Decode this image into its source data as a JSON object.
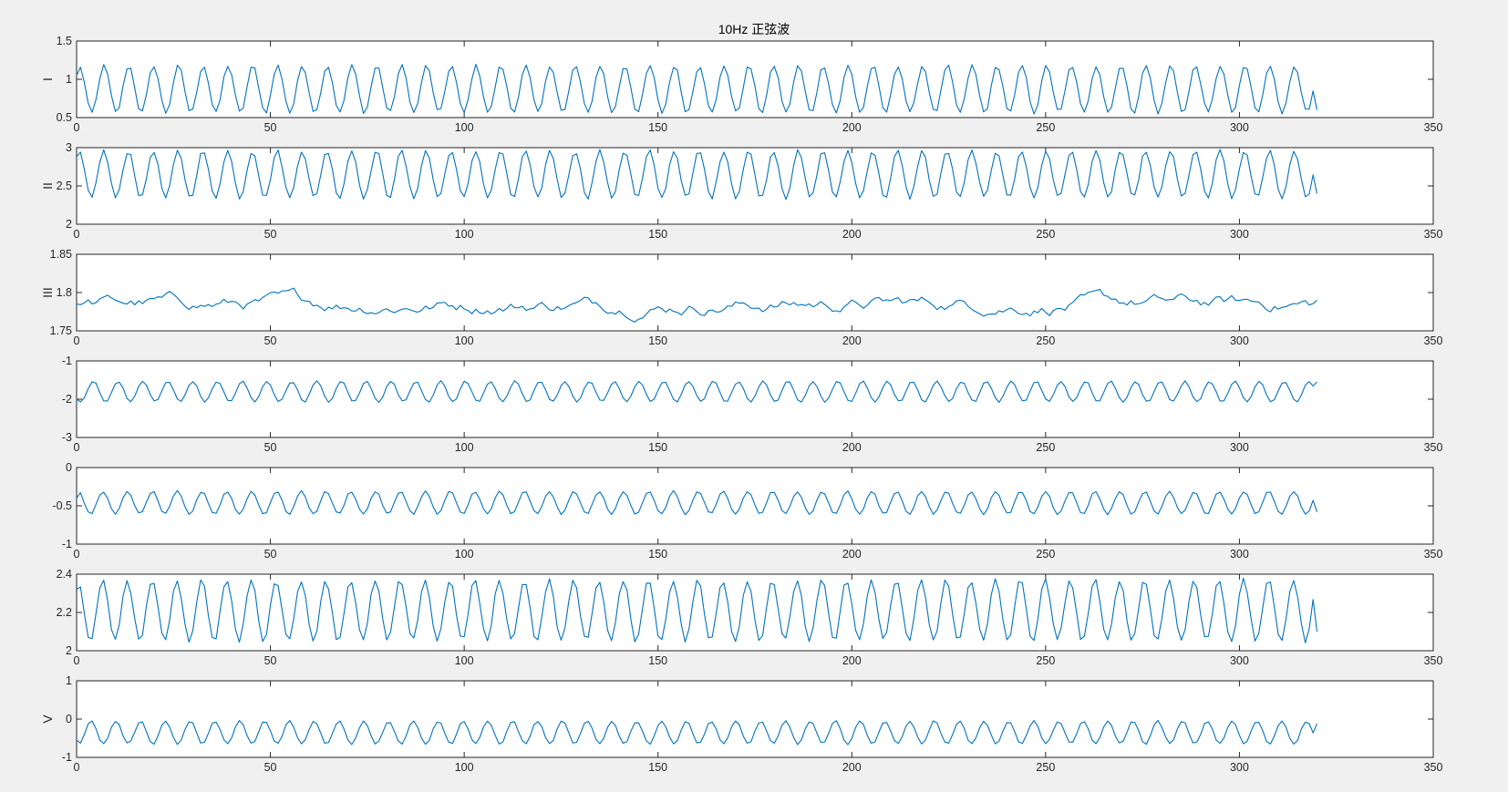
{
  "figure": {
    "title": "10Hz 正弦波",
    "background": "#f0f0f0",
    "axes_color": "#262626",
    "line_color": "#0072bd"
  },
  "chart_data": [
    {
      "type": "line",
      "ylabel": "I",
      "xlim": [
        0,
        350
      ],
      "ylim": [
        0.5,
        1.5
      ],
      "xticks": [
        0,
        50,
        100,
        150,
        200,
        250,
        300,
        350
      ],
      "yticks": [
        0.5,
        1,
        1.5
      ],
      "ytick_labels": [
        "0.5",
        "1",
        "1.5"
      ],
      "x_start": 0,
      "x_end": 320,
      "period": 6.4,
      "mean": 0.87,
      "amplitude": 0.31,
      "peak": 1.18,
      "trough": 0.55,
      "first_value": 1.05,
      "last_value": 0.6
    },
    {
      "type": "line",
      "ylabel": "II",
      "xlim": [
        0,
        350
      ],
      "ylim": [
        2,
        3
      ],
      "xticks": [
        0,
        50,
        100,
        150,
        200,
        250,
        300,
        350
      ],
      "yticks": [
        2,
        2.5,
        3
      ],
      "ytick_labels": [
        "2",
        "2.5",
        "3"
      ],
      "x_start": 0,
      "x_end": 320,
      "period": 6.4,
      "mean": 2.65,
      "amplitude": 0.31,
      "peak": 2.96,
      "trough": 2.34,
      "first_value": 2.88,
      "last_value": 2.4
    },
    {
      "type": "line",
      "ylabel": "III",
      "xlim": [
        0,
        350
      ],
      "ylim": [
        1.75,
        1.85
      ],
      "xticks": [
        0,
        50,
        100,
        150,
        200,
        250,
        300,
        350
      ],
      "yticks": [
        1.75,
        1.8,
        1.85
      ],
      "ytick_labels": [
        "1.75",
        "1.8",
        "1.85"
      ],
      "x_start": 0,
      "x_end": 320,
      "mean": 1.785,
      "noise_range": [
        1.755,
        1.818
      ],
      "first_value": 1.785,
      "last_value": 1.79,
      "noisy": true
    },
    {
      "type": "line",
      "ylabel": "",
      "xlim": [
        0,
        350
      ],
      "ylim": [
        -3,
        -1
      ],
      "xticks": [
        0,
        50,
        100,
        150,
        200,
        250,
        300,
        350
      ],
      "yticks": [
        -3,
        -2,
        -1
      ],
      "ytick_labels": [
        "-3",
        "-2",
        "-1"
      ],
      "x_start": 0,
      "x_end": 320,
      "period": 6.4,
      "mean": -1.8,
      "amplitude": 0.27,
      "peak": -1.53,
      "trough": -2.07,
      "first_value": -2.0,
      "last_value": -1.55
    },
    {
      "type": "line",
      "ylabel": "",
      "xlim": [
        0,
        350
      ],
      "ylim": [
        -1,
        0
      ],
      "xticks": [
        0,
        50,
        100,
        150,
        200,
        250,
        300,
        350
      ],
      "yticks": [
        -1,
        -0.5,
        0
      ],
      "ytick_labels": [
        "-1",
        "-0.5",
        "0"
      ],
      "x_start": 0,
      "x_end": 320,
      "period": 6.4,
      "mean": -0.46,
      "amplitude": 0.15,
      "peak": -0.31,
      "trough": -0.61,
      "first_value": -0.4,
      "last_value": -0.58
    },
    {
      "type": "line",
      "ylabel": "",
      "xlim": [
        0,
        350
      ],
      "ylim": [
        2,
        2.4
      ],
      "xticks": [
        0,
        50,
        100,
        150,
        200,
        250,
        300,
        350
      ],
      "yticks": [
        2,
        2.2,
        2.4
      ],
      "ytick_labels": [
        "2",
        "2.2",
        "2.4"
      ],
      "x_start": 0,
      "x_end": 320,
      "period": 6.4,
      "mean": 2.21,
      "amplitude": 0.16,
      "peak": 2.37,
      "trough": 2.05,
      "first_value": 2.32,
      "last_value": 2.1
    },
    {
      "type": "line",
      "ylabel": "V",
      "xlim": [
        0,
        350
      ],
      "ylim": [
        -1,
        1
      ],
      "xticks": [
        0,
        50,
        100,
        150,
        200,
        250,
        300,
        350
      ],
      "yticks": [
        -1,
        0,
        1
      ],
      "ytick_labels": [
        "-1",
        "0",
        "1"
      ],
      "x_start": 0,
      "x_end": 320,
      "period": 6.4,
      "mean": -0.35,
      "amplitude": 0.3,
      "peak": -0.05,
      "trough": -0.66,
      "first_value": -0.55,
      "last_value": -0.12
    }
  ]
}
